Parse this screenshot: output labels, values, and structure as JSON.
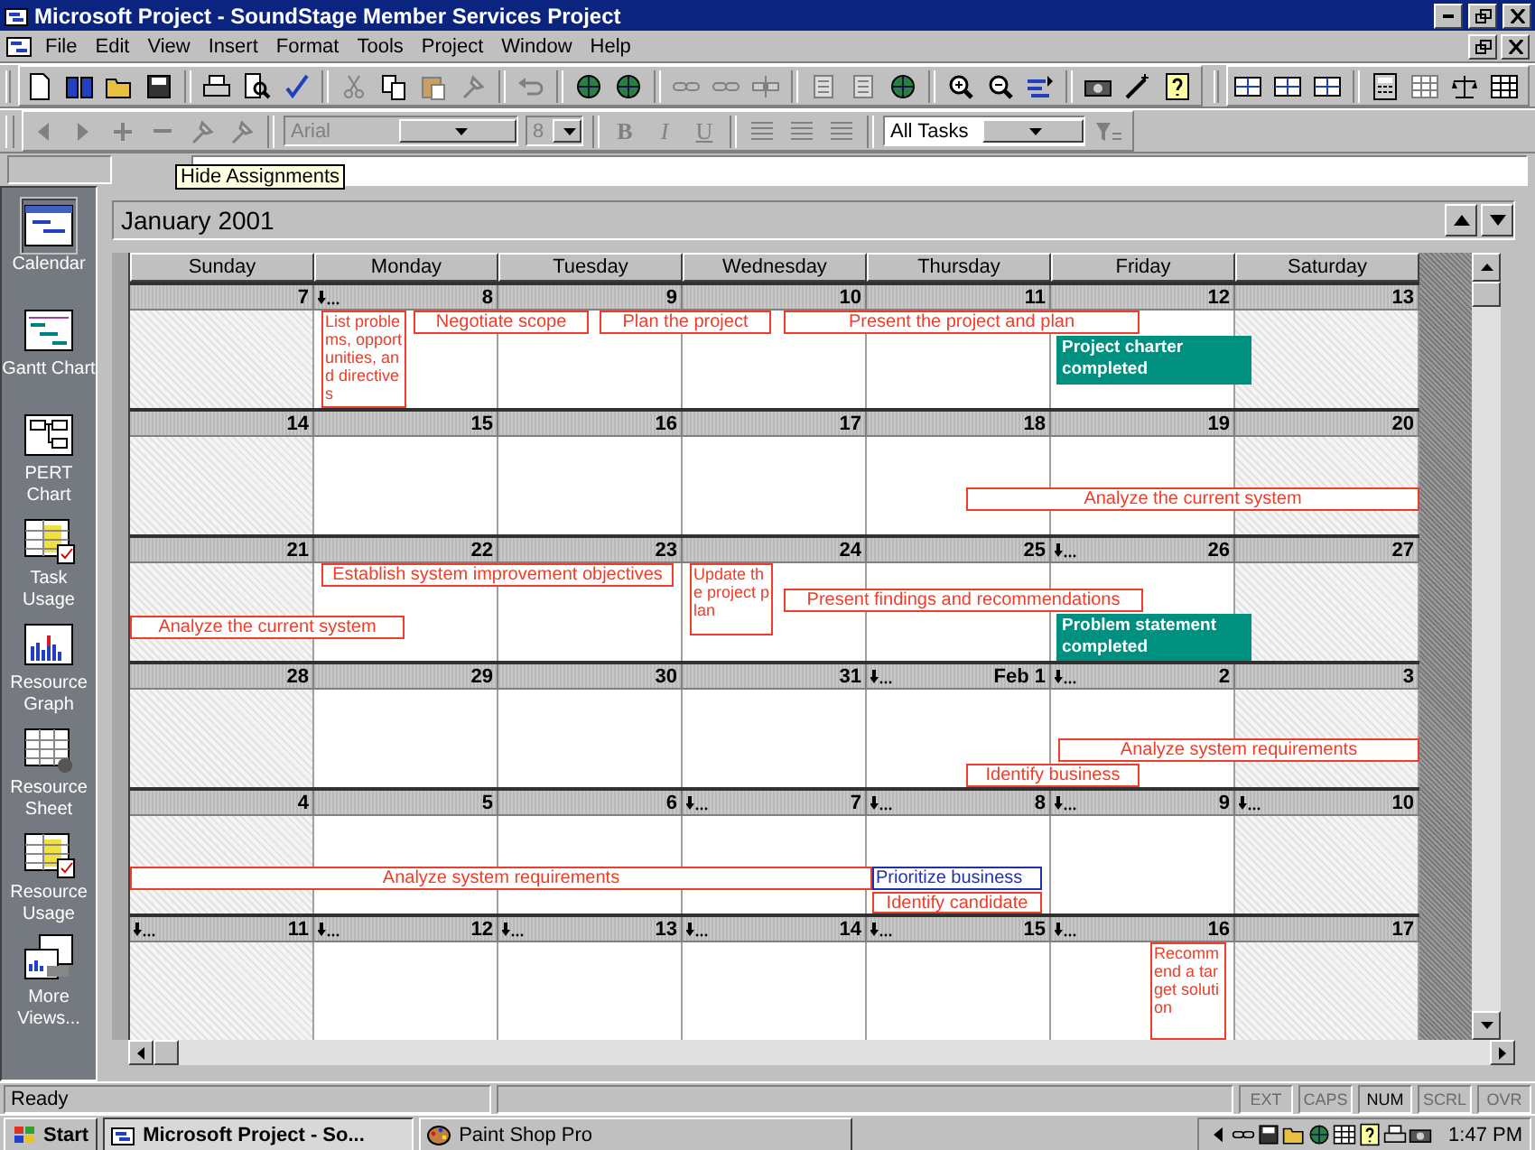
{
  "window": {
    "title": "Microsoft Project - SoundStage Member Services Project"
  },
  "menu": [
    "File",
    "Edit",
    "View",
    "Insert",
    "Format",
    "Tools",
    "Project",
    "Window",
    "Help"
  ],
  "formatting": {
    "font": {
      "value": "Arial",
      "disabled": true
    },
    "size": {
      "value": "8",
      "disabled": true
    },
    "buttons": [
      {
        "label": "B",
        "disabled": true
      },
      {
        "label": "I",
        "disabled": true
      },
      {
        "label": "U",
        "disabled": true
      }
    ],
    "filter": {
      "value": "All Tasks"
    }
  },
  "tooltip": "Hide Assignments",
  "view_bar": [
    {
      "label": "Calendar",
      "selected": true
    },
    {
      "label": "Gantt Chart",
      "selected": false
    },
    {
      "label": "PERT Chart",
      "selected": false
    },
    {
      "label": "Task Usage",
      "selected": false
    },
    {
      "label": "Resource Graph",
      "selected": false
    },
    {
      "label": "Resource Sheet",
      "selected": false
    },
    {
      "label": "Resource Usage",
      "selected": false
    },
    {
      "label": "More Views...",
      "selected": false
    }
  ],
  "calendar": {
    "month": "January 2001",
    "weekdays": [
      "Sunday",
      "Monday",
      "Tuesday",
      "Wednesday",
      "Thursday",
      "Friday",
      "Saturday"
    ],
    "weeks": [
      {
        "days": [
          {
            "label": "7",
            "more": false
          },
          {
            "label": "8",
            "more": true
          },
          {
            "label": "9",
            "more": false
          },
          {
            "label": "10",
            "more": false
          },
          {
            "label": "11",
            "more": false
          },
          {
            "label": "12",
            "more": false
          },
          {
            "label": "13",
            "more": false
          }
        ],
        "tasks": [
          {
            "name": "List problems, opportunities, and directives",
            "kind": "task",
            "selected": false
          },
          {
            "name": "Negotiate scope",
            "kind": "task",
            "selected": false
          },
          {
            "name": "Plan the project",
            "kind": "task",
            "selected": false
          },
          {
            "name": "Present the project and plan",
            "kind": "task",
            "selected": false
          },
          {
            "name": "Project charter completed",
            "kind": "milestone",
            "selected": false
          }
        ]
      },
      {
        "days": [
          {
            "label": "14",
            "more": false
          },
          {
            "label": "15",
            "more": false
          },
          {
            "label": "16",
            "more": false
          },
          {
            "label": "17",
            "more": false
          },
          {
            "label": "18",
            "more": false
          },
          {
            "label": "19",
            "more": false
          },
          {
            "label": "20",
            "more": false
          }
        ],
        "tasks": [
          {
            "name": "Analyze the current system",
            "kind": "task",
            "selected": false
          }
        ]
      },
      {
        "days": [
          {
            "label": "21",
            "more": false
          },
          {
            "label": "22",
            "more": false
          },
          {
            "label": "23",
            "more": false
          },
          {
            "label": "24",
            "more": false
          },
          {
            "label": "25",
            "more": false
          },
          {
            "label": "26",
            "more": true
          },
          {
            "label": "27",
            "more": false
          }
        ],
        "tasks": [
          {
            "name": "Establish system improvement objectives",
            "kind": "task",
            "selected": false
          },
          {
            "name": "Update the project plan",
            "kind": "task",
            "selected": false
          },
          {
            "name": "Present findings and recommendations",
            "kind": "task",
            "selected": false
          },
          {
            "name": "Analyze the current system",
            "kind": "task",
            "selected": false
          },
          {
            "name": "Problem statement completed",
            "kind": "milestone",
            "selected": false
          }
        ]
      },
      {
        "days": [
          {
            "label": "28",
            "more": false
          },
          {
            "label": "29",
            "more": false
          },
          {
            "label": "30",
            "more": false
          },
          {
            "label": "31",
            "more": false
          },
          {
            "label": "Feb 1",
            "more": true
          },
          {
            "label": "2",
            "more": true
          },
          {
            "label": "3",
            "more": false
          }
        ],
        "tasks": [
          {
            "name": "Analyze system requirements",
            "kind": "task",
            "selected": false
          },
          {
            "name": "Identify business",
            "kind": "task",
            "selected": false
          }
        ]
      },
      {
        "days": [
          {
            "label": "4",
            "more": false
          },
          {
            "label": "5",
            "more": false
          },
          {
            "label": "6",
            "more": false
          },
          {
            "label": "7",
            "more": true
          },
          {
            "label": "8",
            "more": true
          },
          {
            "label": "9",
            "more": true
          },
          {
            "label": "10",
            "more": true
          }
        ],
        "tasks": [
          {
            "name": "Analyze system requirements",
            "kind": "task",
            "selected": false
          },
          {
            "name": "Prioritize business",
            "kind": "task",
            "selected": true
          },
          {
            "name": "Identify candidate",
            "kind": "task",
            "selected": false
          }
        ]
      },
      {
        "days": [
          {
            "label": "11",
            "more": true
          },
          {
            "label": "12",
            "more": true
          },
          {
            "label": "13",
            "more": true
          },
          {
            "label": "14",
            "more": true
          },
          {
            "label": "15",
            "more": true
          },
          {
            "label": "16",
            "more": true
          },
          {
            "label": "17",
            "more": false
          }
        ],
        "tasks": [
          {
            "name": "Recommend a target solution",
            "kind": "task",
            "selected": false
          }
        ]
      }
    ]
  },
  "status_bar": {
    "text": "Ready",
    "indicators": [
      {
        "label": "EXT",
        "on": false
      },
      {
        "label": "CAPS",
        "on": false
      },
      {
        "label": "NUM",
        "on": true
      },
      {
        "label": "SCRL",
        "on": false
      },
      {
        "label": "OVR",
        "on": false
      }
    ]
  },
  "taskbar": {
    "start": "Start",
    "buttons": [
      {
        "label": "Microsoft Project - So...",
        "selected": true
      },
      {
        "label": "Paint Shop Pro",
        "selected": false
      }
    ],
    "clock": "1:47 PM"
  }
}
